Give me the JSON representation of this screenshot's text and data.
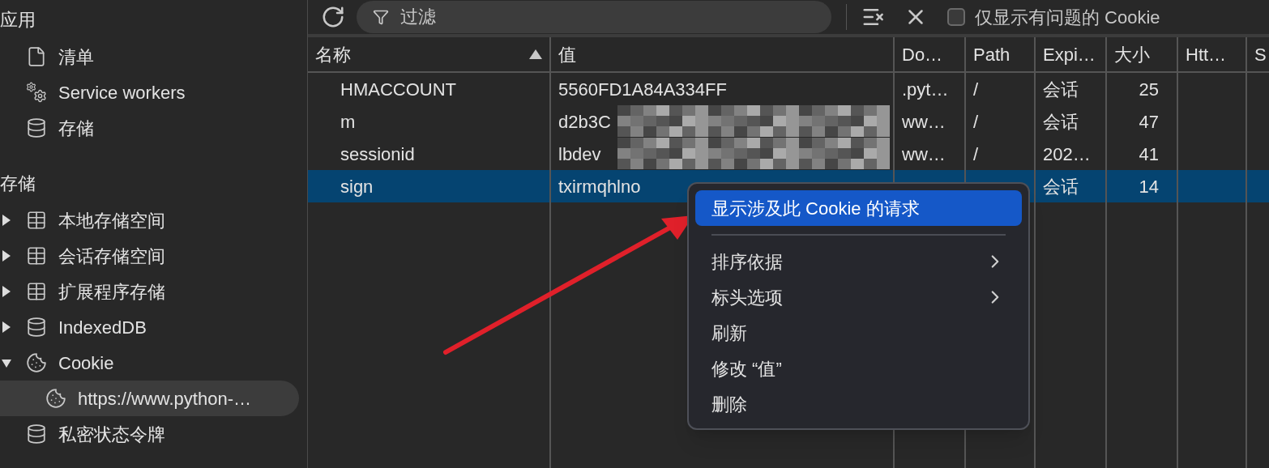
{
  "sidebar": {
    "sections": [
      {
        "title": "应用",
        "items": [
          {
            "label": "清单",
            "kind": "file"
          },
          {
            "label": "Service workers",
            "kind": "gears"
          },
          {
            "label": "存储",
            "kind": "database"
          }
        ]
      },
      {
        "title": "存储",
        "items": [
          {
            "label": "本地存储空间",
            "kind": "table",
            "expanded": false
          },
          {
            "label": "会话存储空间",
            "kind": "table",
            "expanded": false
          },
          {
            "label": "扩展程序存储",
            "kind": "table",
            "expanded": false
          },
          {
            "label": "IndexedDB",
            "kind": "database",
            "expanded": false
          },
          {
            "label": "Cookie",
            "kind": "cookie",
            "expanded": true,
            "children": [
              {
                "label": "https://www.python-…",
                "kind": "cookie",
                "selected": true
              }
            ]
          },
          {
            "label": "私密状态令牌",
            "kind": "database"
          }
        ]
      }
    ]
  },
  "toolbar": {
    "filter": {
      "placeholder": "过滤"
    },
    "only_issues": {
      "label": "仅显示有问题的 Cookie",
      "checked": false
    }
  },
  "table": {
    "columns": [
      {
        "label": "名称",
        "sorted": true
      },
      {
        "label": "值",
        "sorted": false
      },
      {
        "label": "Do…",
        "sorted": false
      },
      {
        "label": "Path",
        "sorted": false
      },
      {
        "label": "Expi…",
        "sorted": false
      },
      {
        "label": "大小",
        "sorted": false
      },
      {
        "label": "Htt…",
        "sorted": false
      },
      {
        "label": "S",
        "sorted": false
      }
    ],
    "rows": [
      {
        "cells": [
          "HMACCOUNT",
          "5560FD1A84A334FF",
          ".pyt…",
          "/",
          "会话",
          "25"
        ],
        "redacted": false,
        "selected": false
      },
      {
        "cells": [
          "m",
          "d2b3C",
          "ww…",
          "/",
          "会话",
          "47"
        ],
        "redacted": true,
        "selected": false
      },
      {
        "cells": [
          "sessionid",
          "lbdev",
          "ww…",
          "/",
          "202…",
          "41"
        ],
        "redacted": true,
        "selected": false
      },
      {
        "cells": [
          "sign",
          "txirmqhlno",
          "",
          "",
          "会话",
          "14"
        ],
        "redacted": false,
        "selected": true
      }
    ]
  },
  "context_menu": {
    "items": [
      {
        "label": "显示涉及此 Cookie 的请求",
        "kind": "item",
        "selected": true
      },
      {
        "kind": "separator"
      },
      {
        "label": "排序依据",
        "kind": "submenu",
        "selected": false
      },
      {
        "label": "标头选项",
        "kind": "submenu",
        "selected": false
      },
      {
        "label": "刷新",
        "kind": "item",
        "selected": false
      },
      {
        "label": "修改 “值”",
        "kind": "item",
        "selected": false
      },
      {
        "label": "删除",
        "kind": "item",
        "selected": false
      }
    ]
  }
}
